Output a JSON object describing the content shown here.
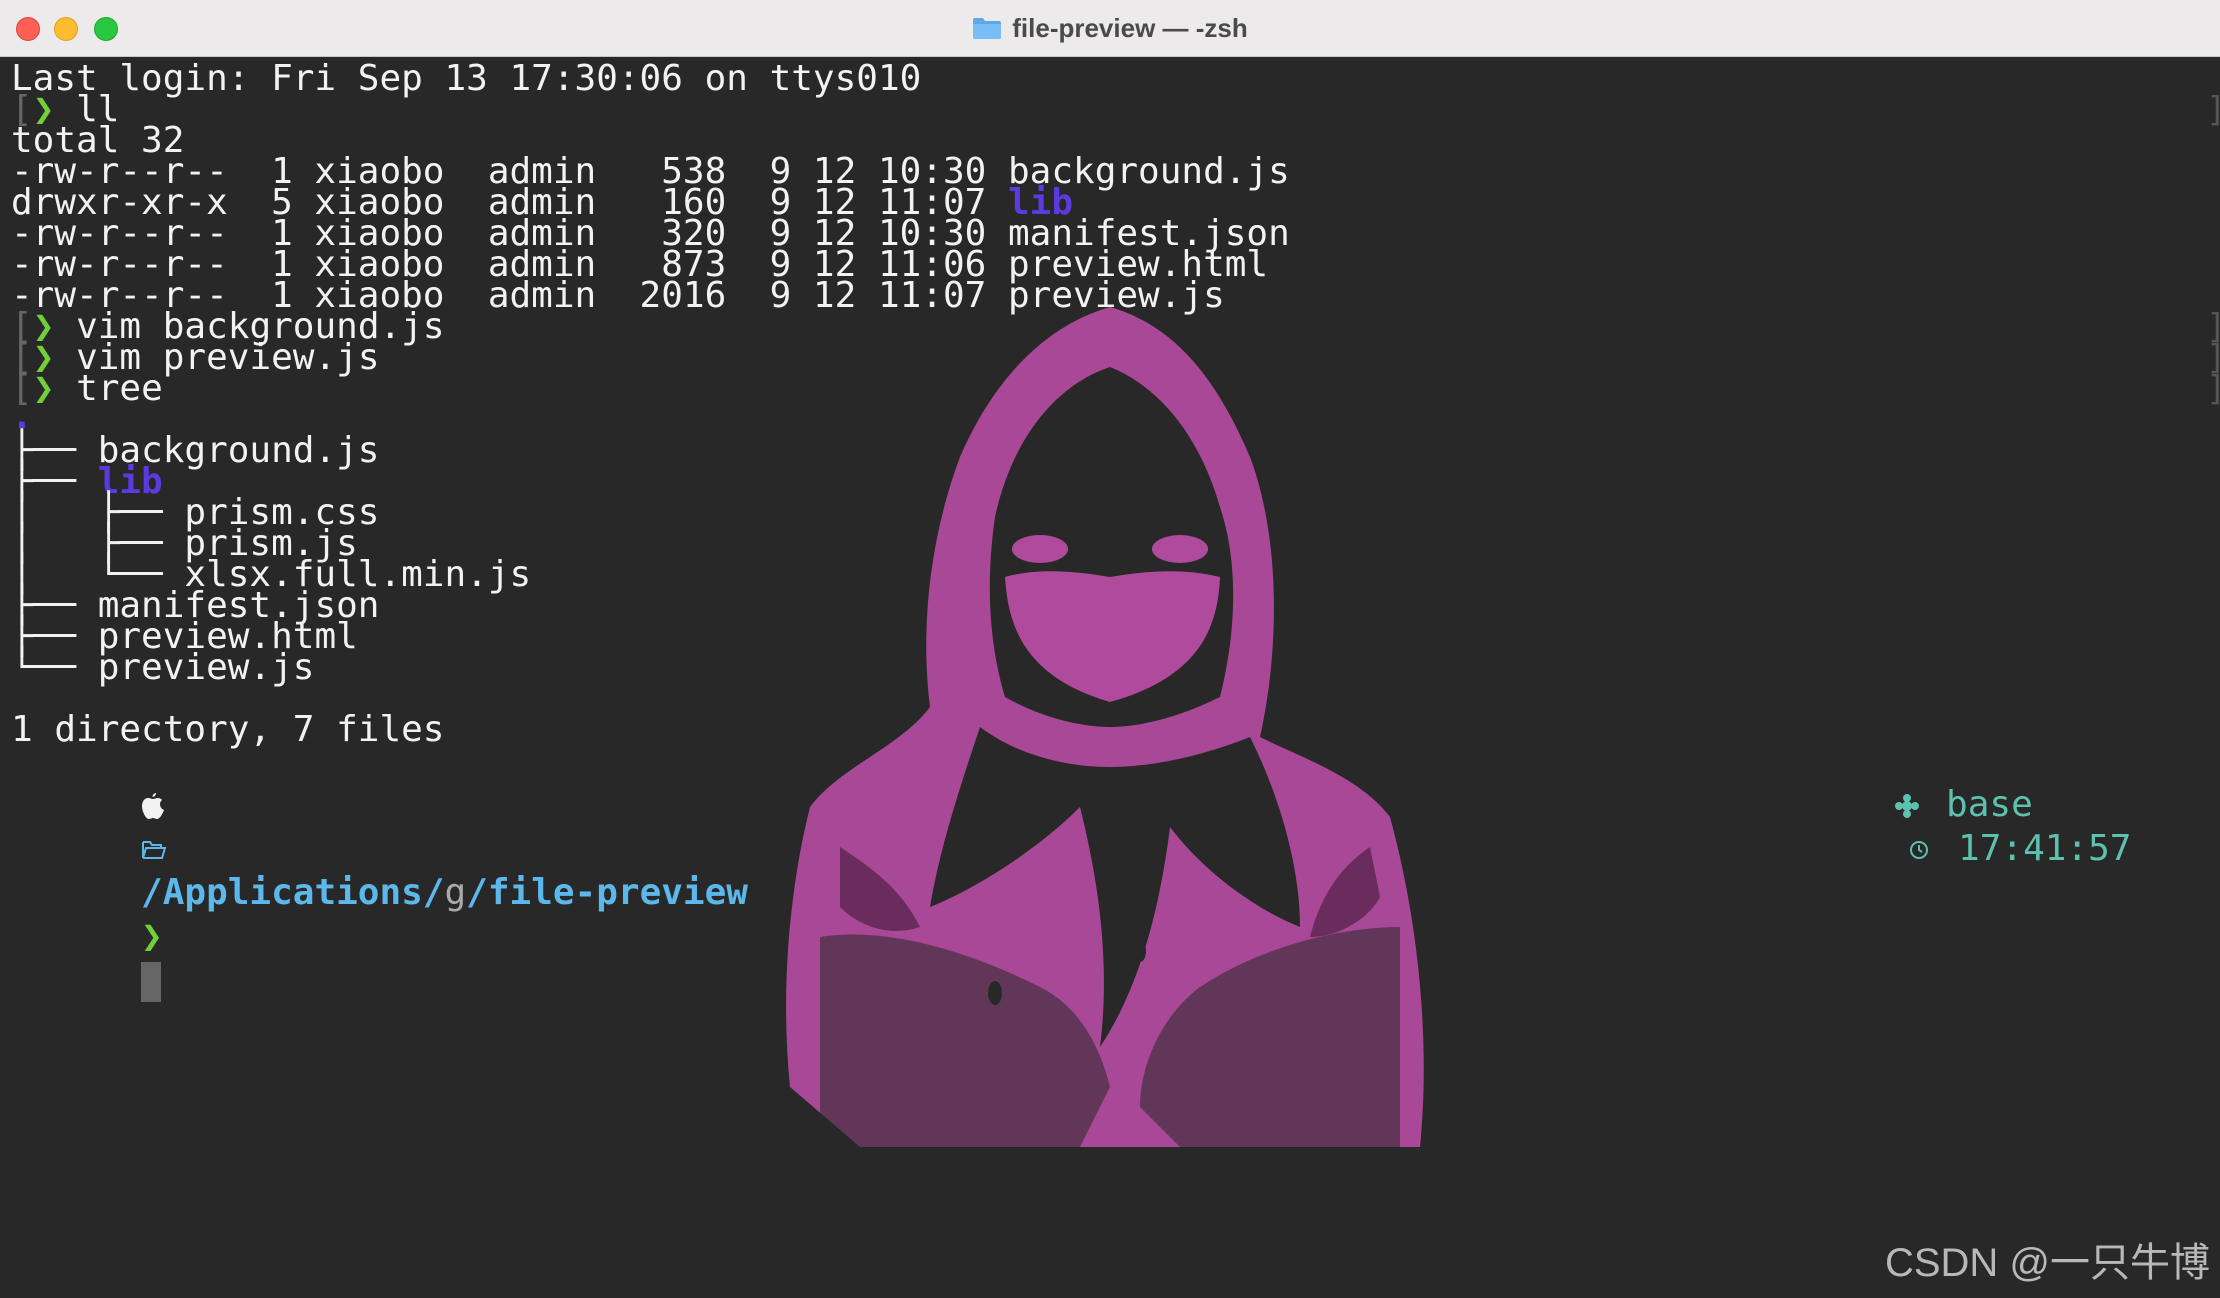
{
  "window": {
    "title": "file-preview — -zsh"
  },
  "terminal": {
    "last_login": "Last login: Fri Sep 13 17:30:06 on ttys010",
    "prompt_symbol": "❯",
    "cmd_ll": "ll",
    "total": "total 32",
    "listing": [
      {
        "prefix": "-rw-r--r--  1 xiaobo  admin   538  9 12 10:30 ",
        "name": "background.js",
        "is_dir": false
      },
      {
        "prefix": "drwxr-xr-x  5 xiaobo  admin   160  9 12 11:07 ",
        "name": "lib",
        "is_dir": true
      },
      {
        "prefix": "-rw-r--r--  1 xiaobo  admin   320  9 12 10:30 ",
        "name": "manifest.json",
        "is_dir": false
      },
      {
        "prefix": "-rw-r--r--  1 xiaobo  admin   873  9 12 11:06 ",
        "name": "preview.html",
        "is_dir": false
      },
      {
        "prefix": "-rw-r--r--  1 xiaobo  admin  2016  9 12 11:07 ",
        "name": "preview.js",
        "is_dir": false
      }
    ],
    "cmd_vim1": "vim background.js",
    "cmd_vim2": "vim preview.js",
    "cmd_tree": "tree",
    "tree_root": ".",
    "tree": [
      {
        "prefix": "├── ",
        "name": "background.js",
        "is_dir": false
      },
      {
        "prefix": "├── ",
        "name": "lib",
        "is_dir": true
      },
      {
        "prefix": "│   ├── ",
        "name": "prism.css",
        "is_dir": false
      },
      {
        "prefix": "│   ├── ",
        "name": "prism.js",
        "is_dir": false
      },
      {
        "prefix": "│   └── ",
        "name": "xlsx.full.min.js",
        "is_dir": false
      },
      {
        "prefix": "├── ",
        "name": "manifest.json",
        "is_dir": false
      },
      {
        "prefix": "├── ",
        "name": "preview.html",
        "is_dir": false
      },
      {
        "prefix": "└── ",
        "name": "preview.js",
        "is_dir": false
      }
    ],
    "tree_summary": "1 directory, 7 files",
    "status": {
      "path_root": "/Applications/",
      "path_mid": "g",
      "path_sep": "/",
      "path_cwd": "file-preview",
      "env_name": "base",
      "time": "17:41:57"
    }
  },
  "watermark": "CSDN @一只牛博",
  "colors": {
    "prompt": "#6fd03a",
    "dir": "#5b3ae0",
    "path": "#5cb8ea",
    "art": "#b04a9c"
  }
}
